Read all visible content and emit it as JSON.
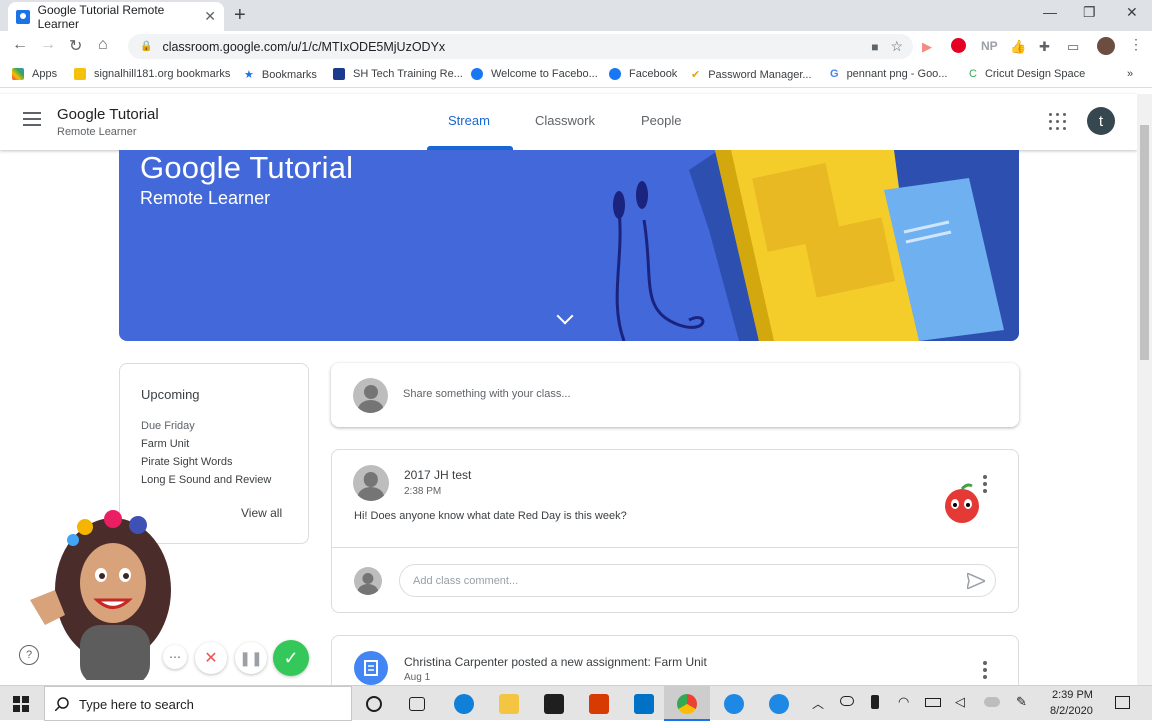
{
  "browser": {
    "tab_title": "Google Tutorial Remote Learner",
    "url": "classroom.google.com/u/1/c/MTIxODE5MjUzODYx",
    "bookmarks": [
      "Apps",
      "signalhill181.org bookmarks",
      "Bookmarks",
      "SH Tech Training Re...",
      "Welcome to Facebo...",
      "Facebook",
      "Password Manager...",
      "pennant png - Goo...",
      "Cricut Design Space"
    ],
    "extension_np": "NP"
  },
  "classroom": {
    "title": "Google Tutorial",
    "subtitle": "Remote Learner",
    "tabs": [
      "Stream",
      "Classwork",
      "People"
    ],
    "profile_initial": "t"
  },
  "banner": {
    "title": "Google Tutorial",
    "subtitle": "Remote Learner"
  },
  "upcoming": {
    "title": "Upcoming",
    "due": "Due Friday",
    "items": [
      "Farm Unit",
      "Pirate Sight Words",
      "Long E Sound and Review"
    ],
    "view_all": "View all"
  },
  "share": {
    "placeholder": "Share something with your class..."
  },
  "post": {
    "author": "2017 JH test",
    "time": "2:38 PM",
    "body": "Hi! Does anyone know what date Red Day is this week?",
    "comment_placeholder": "Add class comment..."
  },
  "assignment": {
    "title": "Christina Carpenter posted a new assignment: Farm Unit",
    "date": "Aug 1"
  },
  "taskbar": {
    "search_placeholder": "Type here to search",
    "time": "2:39 PM",
    "date": "8/2/2020"
  },
  "colors": {
    "accent": "#1967d2",
    "banner": "#4268d9"
  }
}
